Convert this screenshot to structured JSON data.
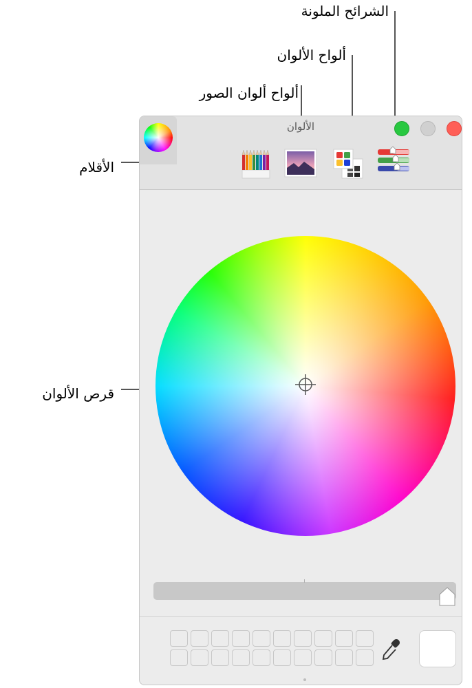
{
  "window": {
    "title": "الألوان",
    "traffic_lights": {
      "close": "#ff5f57",
      "minimize": "#d0d0d0",
      "zoom": "#28c840"
    }
  },
  "callouts": {
    "sliders": "الشرائح الملونة",
    "palettes": "ألواح الألوان",
    "image_palettes": "ألواح ألوان الصور",
    "pencils": "الأقلام",
    "color_wheel": "قرص الألوان"
  },
  "toolbar": {
    "icons": [
      "pencils-icon",
      "image-palette-icon",
      "palette-icon",
      "sliders-icon",
      "color-wheel-icon"
    ],
    "selected": "color-wheel"
  },
  "brightness_slider": {
    "level": 1.0
  },
  "swatches": {
    "rows": 2,
    "columns": 10
  },
  "current_color": "#ffffff"
}
